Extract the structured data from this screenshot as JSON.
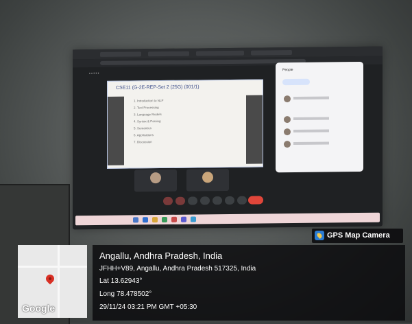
{
  "badge": {
    "label": "GPS Map Camera",
    "icon": "gps-map-camera-icon"
  },
  "map": {
    "logo_text": "Google",
    "pin": "location-pin-icon"
  },
  "location": {
    "title": "Angallu, Andhra Pradesh, India",
    "address": "JFHH+V89, Angallu, Andhra Pradesh 517325, India",
    "lat": "Lat 13.62943°",
    "long": "Long 78.478502°",
    "datetime": "29/11/24 03:21 PM GMT +05:30"
  },
  "projection": {
    "slide_title": "CSE11 (G-2E-REP-Set 2 (25G) (001/1)",
    "slide_lines": [
      "1. Introduction to NLP",
      "2. Text Processing",
      "3. Language Models",
      "4. Syntax & Parsing",
      "5. Semantics",
      "6. Applications",
      "7. Discussion"
    ],
    "people_panel_title": "People"
  }
}
